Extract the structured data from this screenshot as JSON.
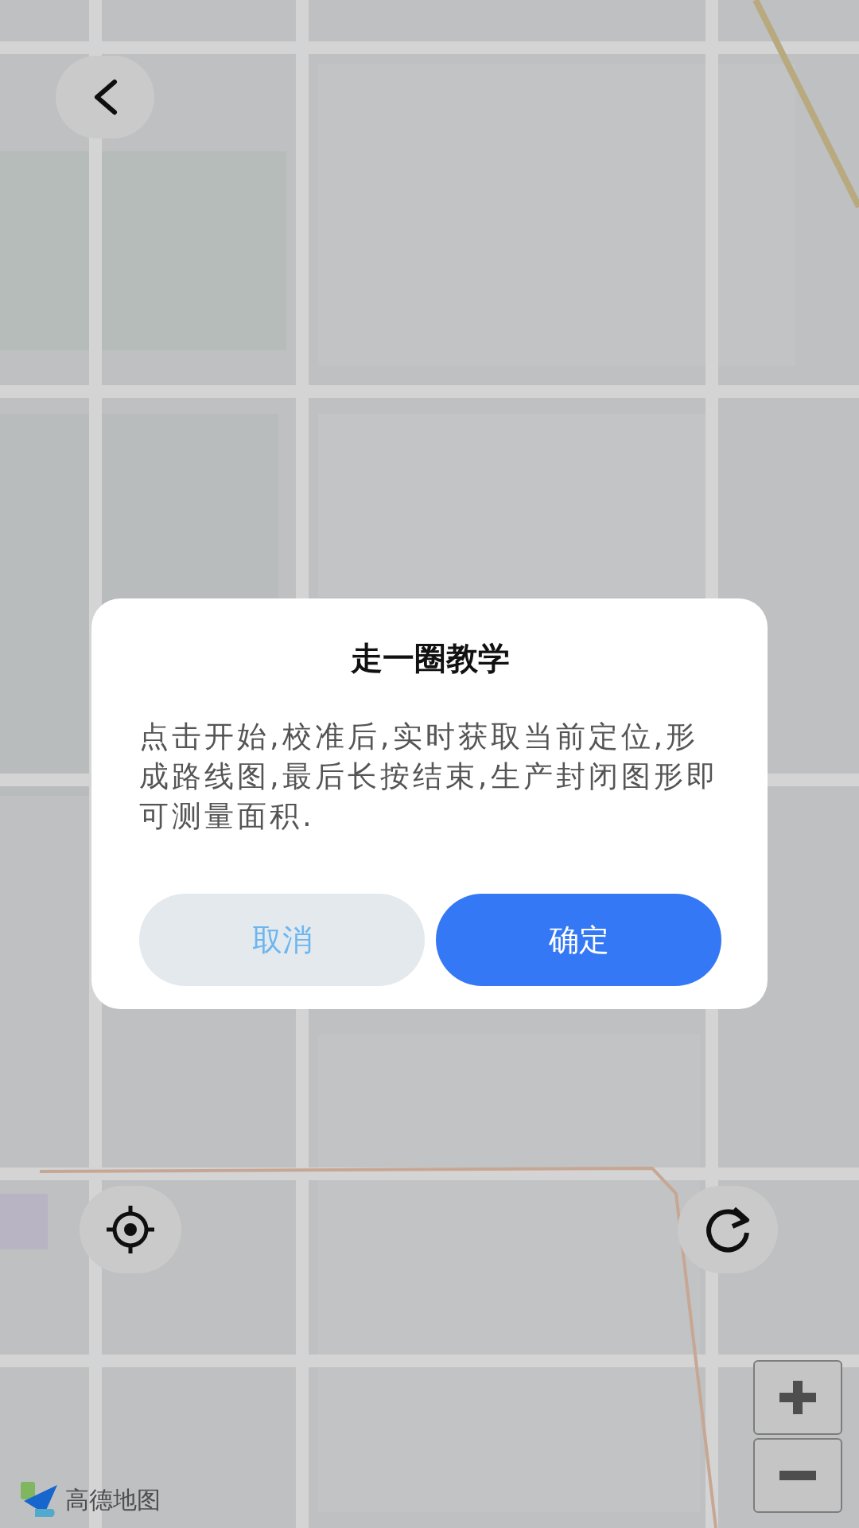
{
  "map": {
    "kind": "picture",
    "logo": "高德地图"
  },
  "dialog": {
    "title": "走一圈教学",
    "message": "点击开始,校准后,实时获取当前定位,形成路线图,最后长按结束,生产封闭图形即可测量面积.",
    "buttons": [
      {
        "label": "取消",
        "kind": "cancel"
      },
      {
        "label": "确定",
        "kind": "confirm"
      }
    ]
  }
}
